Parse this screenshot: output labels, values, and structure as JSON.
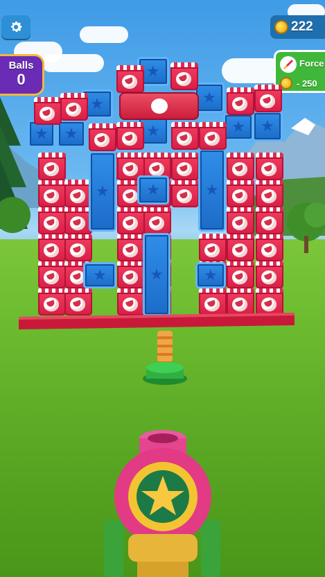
{
  "hud": {
    "balls_label": "Balls",
    "balls_value": "0",
    "coins": "222",
    "power_up": {
      "label": "Force",
      "cost": "- 250"
    }
  },
  "icons": {
    "settings": "gear-icon",
    "coin": "coin-icon",
    "force": "rocket-icon",
    "block_red": "watermelon-icon",
    "block_blue": "star-icon"
  },
  "colors": {
    "red_block": "#e0284f",
    "blue_block": "#2480dc",
    "hud_purple": "#6a2bb5",
    "hud_gold": "#f3b93a",
    "force_green": "#3fb83a"
  }
}
